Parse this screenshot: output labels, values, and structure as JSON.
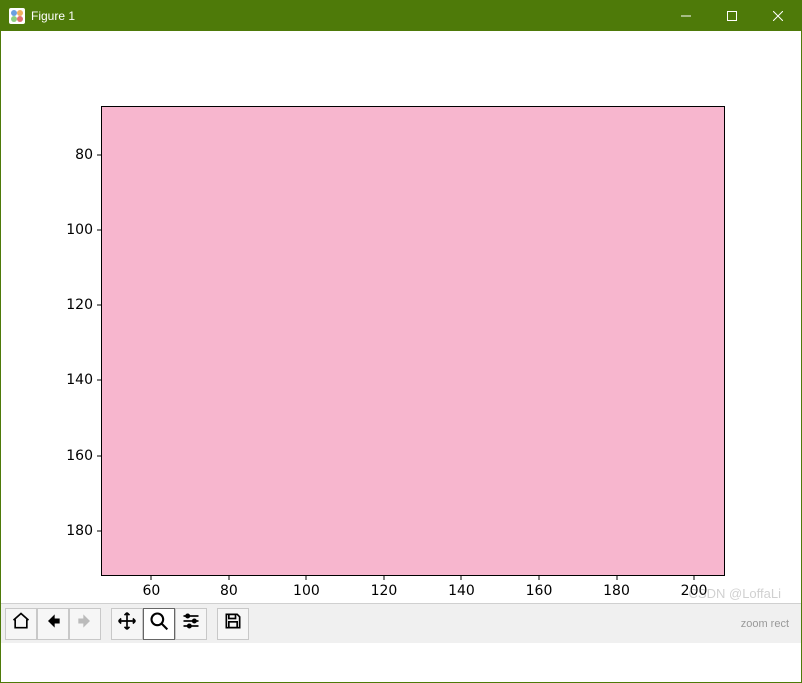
{
  "window": {
    "title": "Figure 1"
  },
  "chart_data": {
    "type": "area",
    "title": "",
    "xlabel": "",
    "ylabel": "",
    "xlim": [
      47,
      208
    ],
    "ylim": [
      192,
      67
    ],
    "xticks": [
      60,
      80,
      100,
      120,
      140,
      160,
      180,
      200
    ],
    "yticks": [
      80,
      100,
      120,
      140,
      160,
      180
    ],
    "face_color": "#f7b6ce",
    "series": []
  },
  "toolbar": {
    "status": "zoom rect",
    "buttons": {
      "home": "Home",
      "back": "Back",
      "forward": "Forward",
      "pan": "Pan",
      "zoom": "Zoom",
      "subplots": "Configure subplots",
      "save": "Save"
    }
  },
  "watermark": "CSDN @LoffaLi"
}
